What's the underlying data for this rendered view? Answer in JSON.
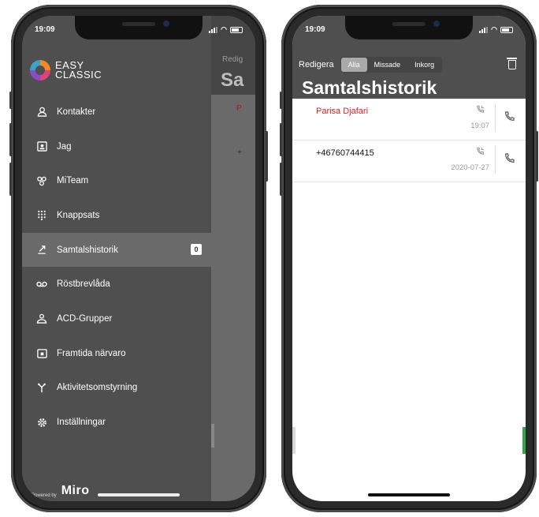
{
  "colors": {
    "drawer_bg": "#4f4f4f",
    "active_item_bg": "#6a6a6a",
    "missed_call_red": "#e02020",
    "accent_green": "#2ea84a"
  },
  "left_phone": {
    "status_time": "19:09",
    "behind": {
      "edit_text": "Redig",
      "title_fragment": "Sa",
      "name_fragment": "P",
      "number_fragment": "+"
    },
    "logo": {
      "line1": "EASY",
      "line2": "CLASSIC"
    },
    "menu": [
      {
        "label": "Kontakter",
        "icon": "person-icon"
      },
      {
        "label": "Jag",
        "icon": "id-card-icon"
      },
      {
        "label": "MiTeam",
        "icon": "team-icon"
      },
      {
        "label": "Knappsats",
        "icon": "keypad-icon"
      },
      {
        "label": "Samtalshistorik",
        "icon": "call-history-icon",
        "badge": "0"
      },
      {
        "label": "Röstbrevlåda",
        "icon": "voicemail-icon"
      },
      {
        "label": "ACD-Grupper",
        "icon": "group-icon"
      },
      {
        "label": "Framtida närvaro",
        "icon": "calendar-icon"
      },
      {
        "label": "Aktivitetsomstyrning",
        "icon": "forward-icon"
      },
      {
        "label": "Inställningar",
        "icon": "gear-icon"
      }
    ],
    "powered_by": {
      "text": "Powered by",
      "brand": "Miro"
    }
  },
  "right_phone": {
    "status_time": "19:09",
    "edit_label": "Redigera",
    "segments": [
      "Alla",
      "Missade",
      "Inkorg"
    ],
    "selected_segment": "Alla",
    "title": "Samtalshistorik",
    "calls": [
      {
        "name": "Parisa Djafari",
        "time": "19:07",
        "missed": true
      },
      {
        "name": "+46760744415",
        "time": "2020-07-27",
        "missed": false
      }
    ]
  }
}
